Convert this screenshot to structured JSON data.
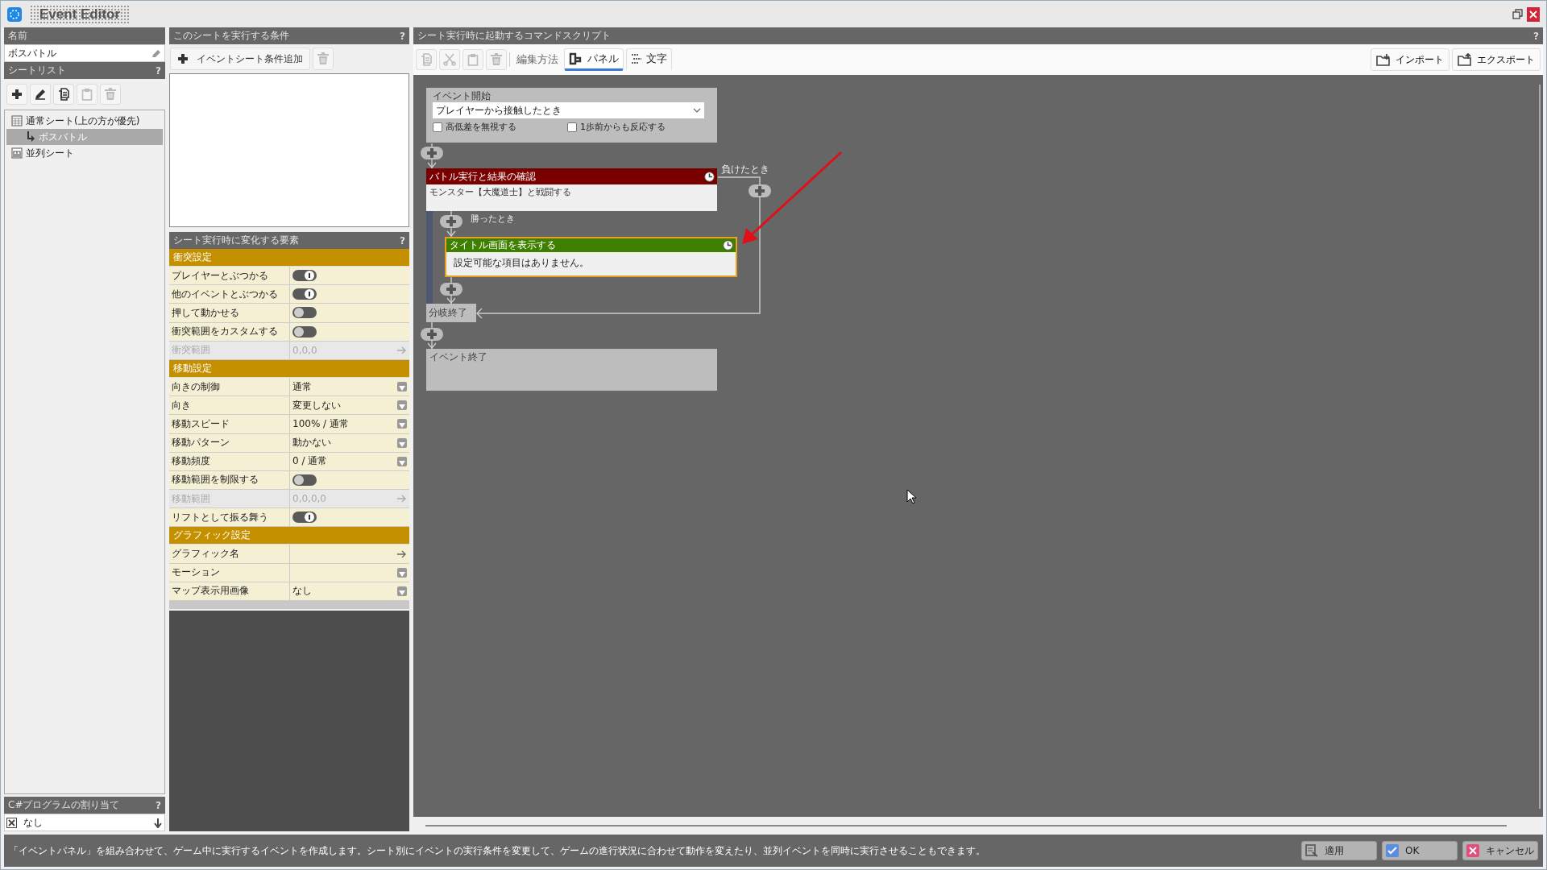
{
  "window": {
    "title": "Event Editor"
  },
  "name_panel": {
    "header": "名前",
    "value": "ボスバトル"
  },
  "sheet_list": {
    "header": "シートリスト",
    "help": "?",
    "tree": [
      {
        "label": "通常シート(上の方が優先)",
        "kind": "normal",
        "selected": false,
        "children": [
          {
            "label": "ボスバトル",
            "selected": true
          }
        ]
      },
      {
        "label": "並列シート",
        "kind": "parallel",
        "selected": false
      }
    ]
  },
  "csharp": {
    "header": "C#プログラムの割り当て",
    "help": "?",
    "value": "なし"
  },
  "conditions": {
    "header": "このシートを実行する条件",
    "help": "?",
    "add_button": "イベントシート条件追加"
  },
  "properties": {
    "header": "シート実行時に変化する要素",
    "help": "?",
    "rows": [
      {
        "kind": "section",
        "label": "衝突設定"
      },
      {
        "kind": "toggle",
        "label": "プレイヤーとぶつかる",
        "on": true
      },
      {
        "kind": "toggle",
        "label": "他のイベントとぶつかる",
        "on": true
      },
      {
        "kind": "toggle",
        "label": "押して動かせる",
        "on": false
      },
      {
        "kind": "toggle",
        "label": "衝突範囲をカスタムする",
        "on": false
      },
      {
        "kind": "link",
        "label": "衝突範囲",
        "value": "0,0,0",
        "disabled": true
      },
      {
        "kind": "section",
        "label": "移動設定"
      },
      {
        "kind": "dropdown",
        "label": "向きの制御",
        "value": "通常"
      },
      {
        "kind": "dropdown",
        "label": "向き",
        "value": "変更しない"
      },
      {
        "kind": "dropdown",
        "label": "移動スピード",
        "value": "100% / 通常"
      },
      {
        "kind": "dropdown",
        "label": "移動パターン",
        "value": "動かない"
      },
      {
        "kind": "dropdown",
        "label": "移動頻度",
        "value": "0 / 通常"
      },
      {
        "kind": "toggle",
        "label": "移動範囲を制限する",
        "on": false
      },
      {
        "kind": "link",
        "label": "移動範囲",
        "value": "0,0,0,0",
        "disabled": true
      },
      {
        "kind": "toggle",
        "label": "リフトとして振る舞う",
        "on": true
      },
      {
        "kind": "section",
        "label": "グラフィック設定"
      },
      {
        "kind": "link",
        "label": "グラフィック名",
        "disabled": false
      },
      {
        "kind": "dropdown",
        "label": "モーション"
      },
      {
        "kind": "dropdown",
        "label": "マップ表示用画像",
        "value": "なし"
      }
    ]
  },
  "script": {
    "header": "シート実行時に起動するコマンドスクリプト",
    "help": "?",
    "edit_mode_label": "編集方法",
    "modes": [
      {
        "kind": "panel",
        "label": "パネル",
        "selected": true
      },
      {
        "kind": "text",
        "label": "文字",
        "selected": false
      }
    ],
    "import_button": "インポート",
    "export_button": "エクスポート",
    "event_start": {
      "title": "イベント開始",
      "trigger": "プレイヤーから接触したとき",
      "options": [
        {
          "label": "高低差を無視する",
          "checked": false
        },
        {
          "label": "1歩前からも反応する",
          "checked": false
        }
      ]
    },
    "battle": {
      "title": "バトル実行と結果の確認",
      "description": "モンスター【大魔道士】と戦闘する",
      "win_label": "勝ったとき",
      "lose_label": "負けたとき"
    },
    "win_command": {
      "title": "タイトル画面を表示する",
      "message": "設定可能な項目はありません。",
      "selected": true
    },
    "branch_end": "分岐終了",
    "event_end": "イベント終了"
  },
  "status_bar": {
    "message": "「イベントパネル」を組み合わせて、ゲーム中に実行するイベントを作成します。シート別にイベントの実行条件を変更して、ゲームの進行状況に合わせて動作を変えたり、並列イベントを同時に実行させることもできます。",
    "buttons": [
      {
        "kind": "apply",
        "label": "適用"
      },
      {
        "kind": "ok",
        "label": "OK"
      },
      {
        "kind": "cancel",
        "label": "キャンセル"
      }
    ]
  }
}
